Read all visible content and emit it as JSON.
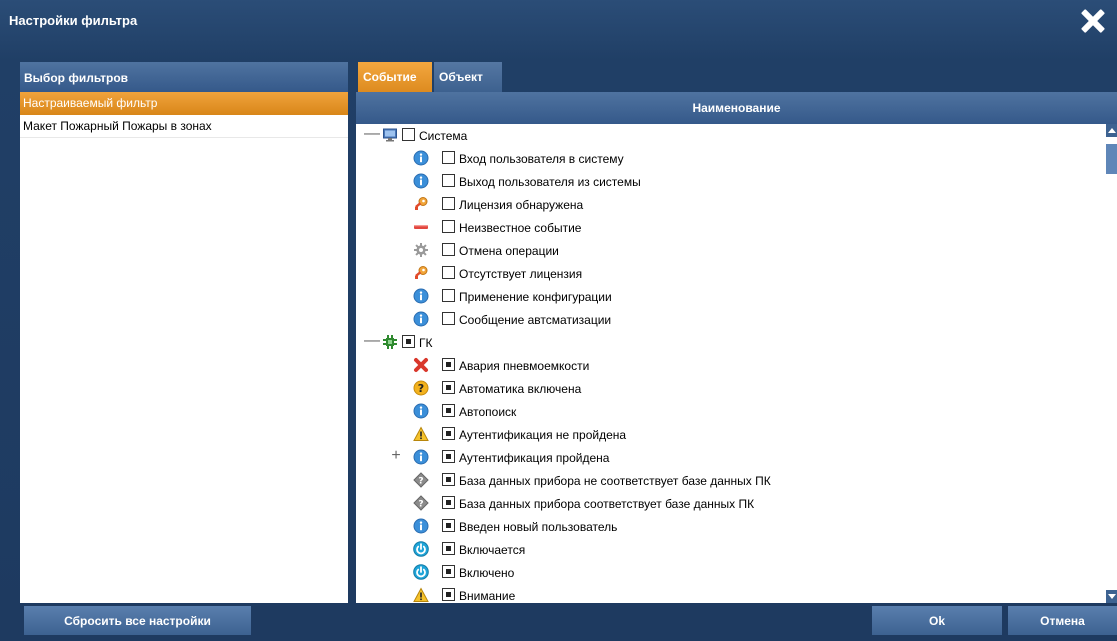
{
  "window": {
    "title": "Настройки фильтра"
  },
  "left": {
    "header": "Выбор фильтров",
    "items": [
      {
        "label": "Настраиваемый фильтр",
        "active": true
      },
      {
        "label": "Макет Пожарный Пожары в зонах",
        "active": false
      }
    ]
  },
  "tabs": [
    {
      "label": "Событие",
      "active": true
    },
    {
      "label": "Объект",
      "active": false
    }
  ],
  "table": {
    "column": "Наименование"
  },
  "tree": [
    {
      "level": 0,
      "toggle": "—",
      "icon": "monitor-icon",
      "checked": "none",
      "label": "Система"
    },
    {
      "level": 1,
      "icon": "info-icon",
      "checked": "none",
      "label": "Вход пользователя в систему"
    },
    {
      "level": 1,
      "icon": "info-icon",
      "checked": "none",
      "label": "Выход пользователя из системы"
    },
    {
      "level": 1,
      "icon": "key-icon",
      "checked": "none",
      "label": "Лицензия обнаружена"
    },
    {
      "level": 1,
      "icon": "minus-bar-icon",
      "checked": "none",
      "label": "Неизвестное событие"
    },
    {
      "level": 1,
      "icon": "gear-icon",
      "checked": "none",
      "label": "Отмена операции"
    },
    {
      "level": 1,
      "icon": "key-icon",
      "checked": "none",
      "label": "Отсутствует лицензия"
    },
    {
      "level": 1,
      "icon": "info-icon",
      "checked": "none",
      "label": "Применение конфигурации"
    },
    {
      "level": 1,
      "icon": "info-icon",
      "checked": "none",
      "label": "Сообщение автсматизации"
    },
    {
      "level": 0,
      "toggle": "—",
      "icon": "chip-icon",
      "checked": "mixed",
      "label": "ГК"
    },
    {
      "level": 1,
      "icon": "error-x-icon",
      "checked": "mixed",
      "label": "Авария пневмоемкости"
    },
    {
      "level": 1,
      "icon": "question-icon",
      "checked": "mixed",
      "label": "Автоматика включена"
    },
    {
      "level": 1,
      "icon": "info-icon",
      "checked": "mixed",
      "label": "Автопоиск"
    },
    {
      "level": 1,
      "icon": "warning-icon",
      "checked": "mixed",
      "label": "Аутентификация не пройдена"
    },
    {
      "level": 1,
      "toggle": "+",
      "icon": "info-icon",
      "checked": "mixed",
      "label": "Аутентификация пройдена"
    },
    {
      "level": 1,
      "icon": "diamond-icon",
      "checked": "mixed",
      "label": "База данных прибора не соответствует базе данных ПК"
    },
    {
      "level": 1,
      "icon": "diamond-icon",
      "checked": "mixed",
      "label": "База данных прибора соответствует базе данных ПК"
    },
    {
      "level": 1,
      "icon": "info-icon",
      "checked": "mixed",
      "label": "Введен новый пользователь"
    },
    {
      "level": 1,
      "icon": "power-icon",
      "checked": "mixed",
      "label": "Включается"
    },
    {
      "level": 1,
      "icon": "power-icon",
      "checked": "mixed",
      "label": "Включено"
    },
    {
      "level": 1,
      "icon": "warning-icon",
      "checked": "mixed",
      "label": "Внимание"
    }
  ],
  "footer": {
    "reset": "Сбросить все настройки",
    "ok": "Ok",
    "cancel": "Отмена"
  }
}
